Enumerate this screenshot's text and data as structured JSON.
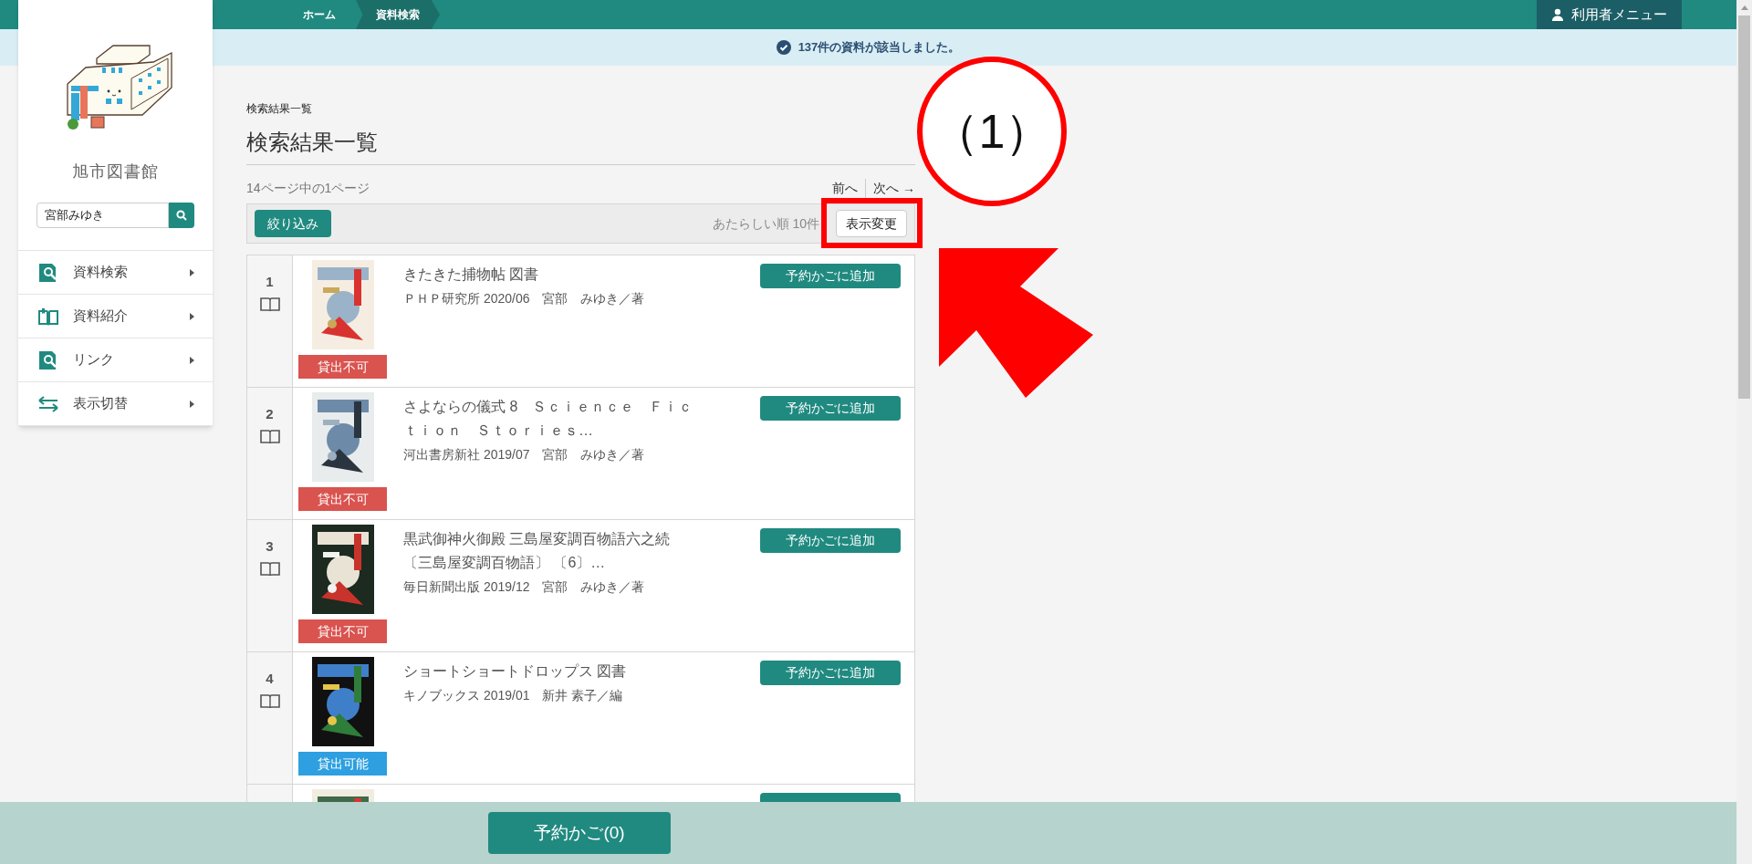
{
  "breadcrumb": [
    {
      "label": "ホーム",
      "selected": false
    },
    {
      "label": "資料検索",
      "selected": true
    }
  ],
  "user_menu": "利用者メニュー",
  "notice": "137件の資料が該当しました。",
  "sidebar": {
    "library_name": "旭市図書館",
    "search": {
      "value": "宮部みゆき"
    },
    "items": [
      {
        "label": "資料検索"
      },
      {
        "label": "資料紹介"
      },
      {
        "label": "リンク"
      },
      {
        "label": "表示切替"
      }
    ]
  },
  "page": {
    "breadcrumb_title": "検索結果一覧",
    "title": "検索結果一覧",
    "page_info": "14ページ中の1ページ",
    "prev": "前へ",
    "next": "次へ →",
    "toolbar": {
      "filter_button": "絞り込み",
      "sort_info": "あたらしい順 10件",
      "display_button": "表示変更"
    }
  },
  "results": [
    {
      "number": "1",
      "status": {
        "label": "貸出不可",
        "available": false
      },
      "title": "きたきた捕物帖 図書",
      "meta": "ＰＨＰ研究所 2020/06　宮部　みゆき／著",
      "button": "予約かごに追加"
    },
    {
      "number": "2",
      "status": {
        "label": "貸出不可",
        "available": false
      },
      "title": "さよならの儀式 8　Ｓｃｉｅｎｃｅ　Ｆｉｃｔｉｏｎ　Ｓｔｏｒｉｅｓ…",
      "meta": "河出書房新社 2019/07　宮部　みゆき／著",
      "button": "予約かごに追加"
    },
    {
      "number": "3",
      "status": {
        "label": "貸出不可",
        "available": false
      },
      "title": "黒武御神火御殿 三島屋変調百物語六之続〔三島屋変調百物語〕 〔6〕…",
      "meta": "毎日新聞出版 2019/12　宮部　みゆき／著",
      "button": "予約かごに追加"
    },
    {
      "number": "4",
      "status": {
        "label": "貸出可能",
        "available": true
      },
      "title": "ショートショートドロップス 図書",
      "meta": "キノブックス 2019/01　新井 素子／編",
      "button": "予約かごに追加"
    }
  ],
  "cart_button": "予約かご(0)",
  "annotation": {
    "label": "（1）"
  }
}
